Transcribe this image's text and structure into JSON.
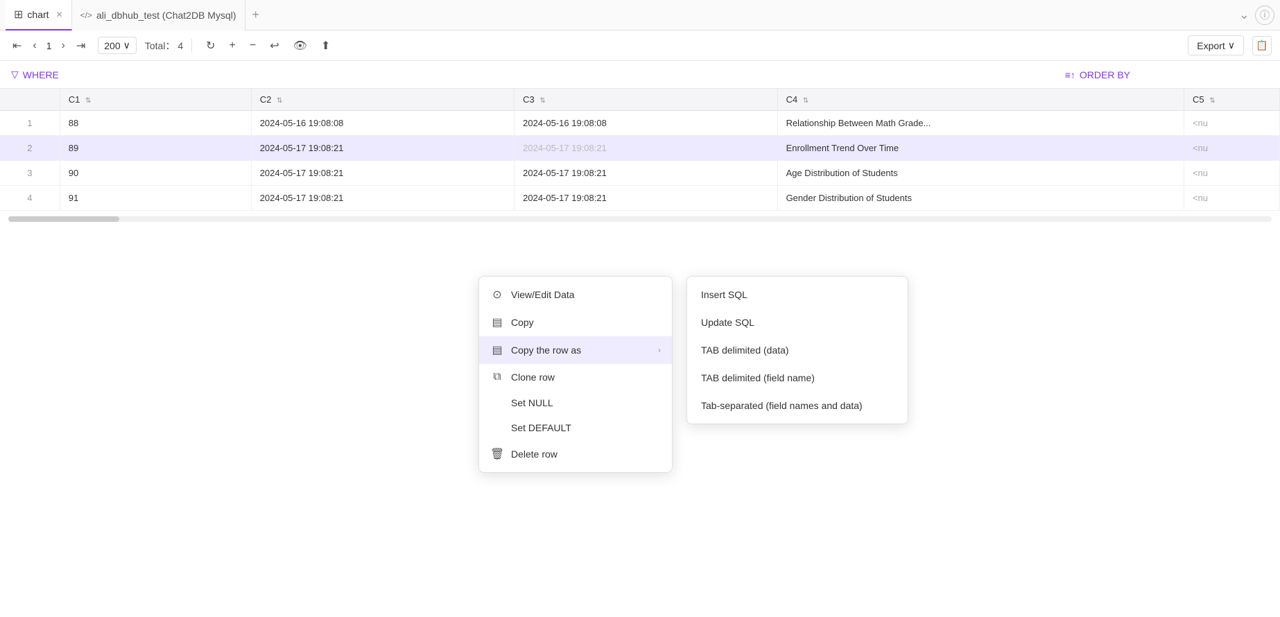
{
  "tabs": [
    {
      "id": "chart",
      "label": "chart",
      "icon": "⊞",
      "active": true,
      "closeable": true
    },
    {
      "id": "query",
      "label": "ali_dbhub_test (Chat2DB Mysql)",
      "icon": "</>",
      "active": false,
      "closeable": false
    }
  ],
  "tab_add_label": "+",
  "tab_dropdown_label": "⌄",
  "tab_info_label": "ⓘ",
  "toolbar": {
    "nav_first": "⟨⟨",
    "nav_prev": "⟨",
    "page": "1",
    "nav_next": "⟩",
    "nav_last": "⟩⟩",
    "per_page": "200",
    "per_page_arrow": "∨",
    "total_label": "Total：",
    "total_value": "4",
    "refresh": "↻",
    "add_row": "+",
    "delete_row": "−",
    "undo": "↩",
    "eye": "👁",
    "upload": "⬆",
    "export_label": "Export",
    "export_arrow": "∨"
  },
  "filter_bar": {
    "where_icon": "▽",
    "where_label": "WHERE",
    "order_icon": "≡↑",
    "order_label": "ORDER BY"
  },
  "table": {
    "columns": [
      {
        "id": "row_num",
        "label": ""
      },
      {
        "id": "c1",
        "label": "C1",
        "sortable": true
      },
      {
        "id": "c2",
        "label": "C2",
        "sortable": true
      },
      {
        "id": "c3",
        "label": "C3",
        "sortable": true
      },
      {
        "id": "c4",
        "label": "C4",
        "sortable": true
      },
      {
        "id": "c5",
        "label": "C5",
        "sortable": true
      }
    ],
    "rows": [
      {
        "num": "1",
        "c1": "88",
        "c2": "2024-05-16 19:08:08",
        "c3": "2024-05-16 19:08:08",
        "c4": "Relationship Between Math Grade...",
        "c5": "<nu"
      },
      {
        "num": "2",
        "c1": "89",
        "c2": "2024-05-17 19:08:21",
        "c3": "2024-05-17 19:08:21",
        "c4": "Enrollment Trend Over Time",
        "c5": "<nu",
        "selected": true
      },
      {
        "num": "3",
        "c1": "90",
        "c2": "2024-05-17 19:08:21",
        "c3": "2024-05-17 19:08:21",
        "c4": "Age Distribution of Students",
        "c5": "<nu"
      },
      {
        "num": "4",
        "c1": "91",
        "c2": "2024-05-17 19:08:21",
        "c3": "2024-05-17 19:08:21",
        "c4": "Gender Distribution of Students",
        "c5": "<nu"
      }
    ]
  },
  "context_menu": {
    "items": [
      {
        "id": "view-edit",
        "icon": "⊙",
        "label": "View/Edit Data",
        "has_submenu": false
      },
      {
        "id": "copy",
        "icon": "▤",
        "label": "Copy",
        "has_submenu": false
      },
      {
        "id": "copy-row-as",
        "icon": "▤",
        "label": "Copy the row as",
        "has_submenu": true,
        "active": true
      },
      {
        "id": "clone-row",
        "icon": "⧉",
        "label": "Clone row",
        "has_submenu": false
      },
      {
        "id": "set-null",
        "icon": "",
        "label": "Set NULL",
        "has_submenu": false
      },
      {
        "id": "set-default",
        "icon": "",
        "label": "Set DEFAULT",
        "has_submenu": false
      },
      {
        "id": "delete-row",
        "icon": "🗑",
        "label": "Delete row",
        "has_submenu": false
      }
    ]
  },
  "submenu": {
    "items": [
      {
        "id": "insert-sql",
        "label": "Insert SQL"
      },
      {
        "id": "update-sql",
        "label": "Update SQL"
      },
      {
        "id": "tab-delimited-data",
        "label": "TAB delimited (data)"
      },
      {
        "id": "tab-delimited-field",
        "label": "TAB delimited (field name)"
      },
      {
        "id": "tab-separated-both",
        "label": "Tab-separated (field names and data)"
      }
    ]
  }
}
